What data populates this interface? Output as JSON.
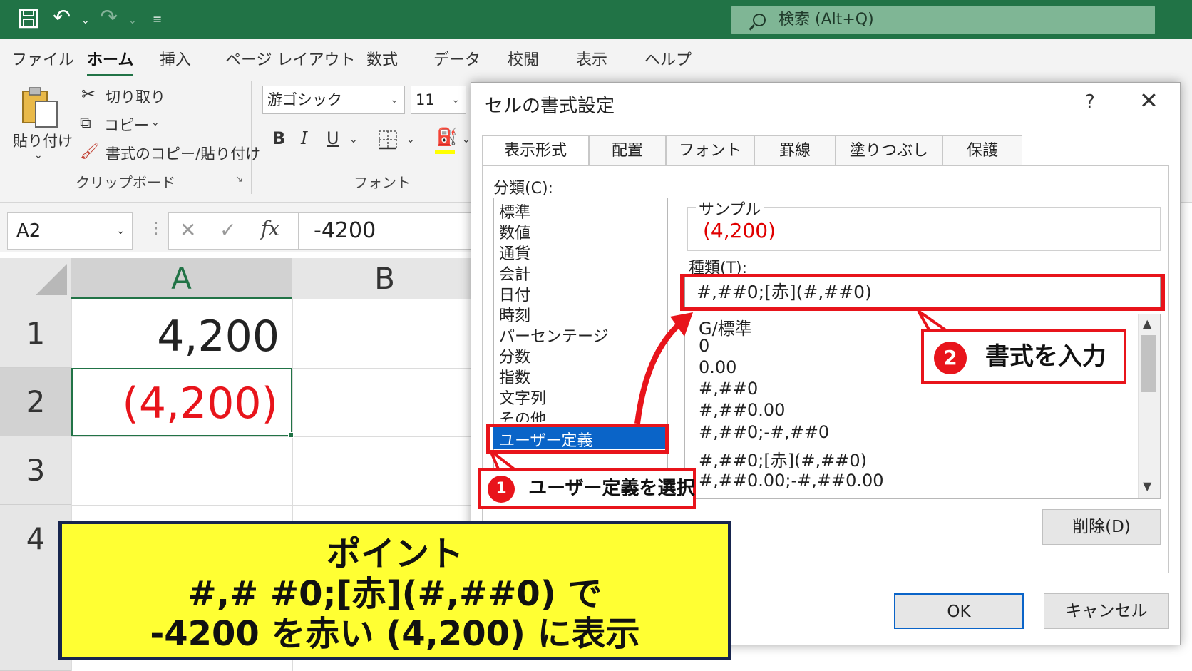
{
  "quick_access": {
    "save_icon": "save-icon",
    "undo_icon": "undo-icon",
    "redo_icon": "redo-icon",
    "customize_icon": "customize-icon"
  },
  "search": {
    "label": "検索 (Alt+Q)"
  },
  "ribbon_tabs": [
    "ファイル",
    "ホーム",
    "挿入",
    "ページ レイアウト",
    "数式",
    "データ",
    "校閲",
    "表示",
    "ヘルプ"
  ],
  "clipboard": {
    "paste": "貼り付け",
    "cut": "切り取り",
    "copy": "コピー",
    "format_painter": "書式のコピー/貼り付け",
    "group_label": "クリップボード"
  },
  "font_group": {
    "font_name": "游ゴシック",
    "font_size": "11",
    "bold": "B",
    "italic": "I",
    "underline": "U",
    "group_label": "フォント"
  },
  "formula_bar": {
    "name_box": "A2",
    "cancel": "✕",
    "enter": "✓",
    "fx": "fx",
    "value": "-4200"
  },
  "sheet": {
    "columns": [
      "A",
      "B"
    ],
    "rows": [
      "1",
      "2",
      "3",
      "4"
    ],
    "a1": "4,200",
    "a2": "(4,200)",
    "negative_color": "#e8141b"
  },
  "dialog": {
    "title": "セルの書式設定",
    "help": "?",
    "close": "✕",
    "tabs": [
      "表示形式",
      "配置",
      "フォント",
      "罫線",
      "塗りつぶし",
      "保護"
    ],
    "category_label": "分類(C):",
    "categories": [
      "標準",
      "数値",
      "通貨",
      "会計",
      "日付",
      "時刻",
      "パーセンテージ",
      "分数",
      "指数",
      "文字列",
      "その他",
      "ユーザー定義"
    ],
    "selected_category": "ユーザー定義",
    "sample_label": "サンプル",
    "sample_value": "(4,200)",
    "type_label": "種類(T):",
    "type_value": "#,##0;[赤](#,##0)",
    "type_list": [
      "G/標準",
      "0",
      "0.00",
      "#,##0",
      "#,##0.00",
      "#,##0;-#,##0",
      "#,##0;[赤](#,##0)",
      "#,##0.00;-#,##0.00"
    ],
    "delete_button": "削除(D)",
    "ok_button": "OK",
    "cancel_button": "キャンセル"
  },
  "annotations": {
    "callout1_num": "1",
    "callout1_text": "ユーザー定義を選択",
    "callout2_num": "2",
    "callout2_text": "書式を入力",
    "point_title": "ポイント",
    "point_line1": "#,# #0;[赤](#,##0) で",
    "point_line2": "-4200 を赤い (4,200) に表示",
    "accent_color": "#e8141b",
    "point_bg": "#ffff33"
  }
}
